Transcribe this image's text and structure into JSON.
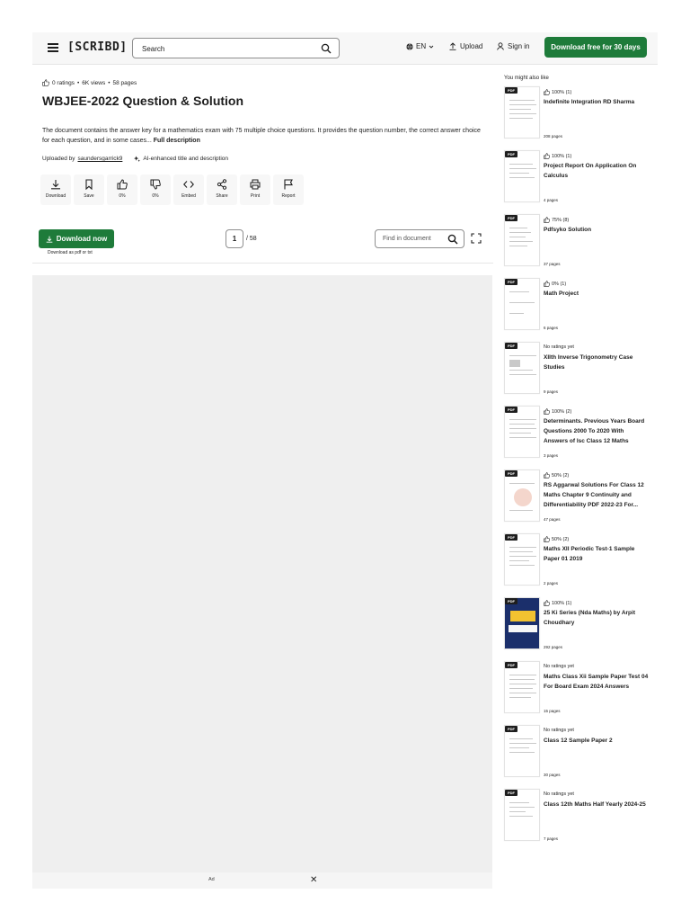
{
  "header": {
    "logo": "[SCRIBD]",
    "search_placeholder": "Search",
    "lang": "EN",
    "upload": "Upload",
    "signin": "Sign in",
    "trial_button": "Download free for 30 days"
  },
  "doc": {
    "ratings": "0 ratings",
    "views": "6K views",
    "pages": "58 pages",
    "title": "WBJEE-2022 Question & Solution",
    "description": "The document contains the answer key for a mathematics exam with 75 multiple choice questions. It provides the question number, the correct answer choice for each question, and in some cases...",
    "full_description": "Full description",
    "uploaded_by_label": "Uploaded by",
    "uploader": "saundersgarrick9",
    "ai_note": "AI-enhanced title and description",
    "actions": [
      {
        "label": "Download",
        "icon": "download-icon"
      },
      {
        "label": "Save",
        "icon": "bookmark-icon"
      },
      {
        "label": "0%",
        "icon": "thumbs-up-icon"
      },
      {
        "label": "0%",
        "icon": "thumbs-down-icon"
      },
      {
        "label": "Embed",
        "icon": "embed-icon"
      },
      {
        "label": "Share",
        "icon": "share-icon"
      },
      {
        "label": "Print",
        "icon": "print-icon"
      },
      {
        "label": "Report",
        "icon": "flag-icon"
      }
    ],
    "download_now": "Download now",
    "download_sub": "Download as pdf or txt",
    "current_page": "1",
    "total_pages": "/ 58",
    "find_placeholder": "Find in document"
  },
  "ad": {
    "label": "Ad",
    "close": "✕"
  },
  "sidebar": {
    "title": "You might also like",
    "items": [
      {
        "rating": "100% (1)",
        "title": "Indefinite Integration RD Sharma",
        "pages": "208 pages"
      },
      {
        "rating": "100% (1)",
        "title": "Project Report On Application On Calculus",
        "pages": "4 pages"
      },
      {
        "rating": "75% (8)",
        "title": "Pdfsyko Solution",
        "pages": "37 pages"
      },
      {
        "rating": "0% (1)",
        "title": "Math Project",
        "pages": "6 pages"
      },
      {
        "rating": "No ratings yet",
        "title": "XIIth Inverse Trigonometry Case Studies",
        "pages": "9 pages"
      },
      {
        "rating": "100% (2)",
        "title": "Determinants. Previous Years Board Questions 2000 To 2020 With Answers of Isc Class 12 Maths",
        "pages": "3 pages"
      },
      {
        "rating": "50% (2)",
        "title": "RS Aggarwal Solutions For Class 12 Maths Chapter 9 Continuity and Differentiability PDF 2022-23 For...",
        "pages": "47 pages"
      },
      {
        "rating": "50% (2)",
        "title": "Maths XII Periodic Test-1 Sample Paper 01 2019",
        "pages": "2 pages"
      },
      {
        "rating": "100% (1)",
        "title": "25 Ki Series (Nda Maths) by Arpit Choudhary",
        "pages": "292 pages"
      },
      {
        "rating": "No ratings yet",
        "title": "Maths Class Xii Sample Paper Test 04 For Board Exam 2024 Answers",
        "pages": "15 pages"
      },
      {
        "rating": "No ratings yet",
        "title": "Class 12 Sample Paper 2",
        "pages": "30 pages"
      },
      {
        "rating": "No ratings yet",
        "title": "Class 12th Maths Half Yearly 2024-25",
        "pages": "7 pages"
      }
    ]
  }
}
